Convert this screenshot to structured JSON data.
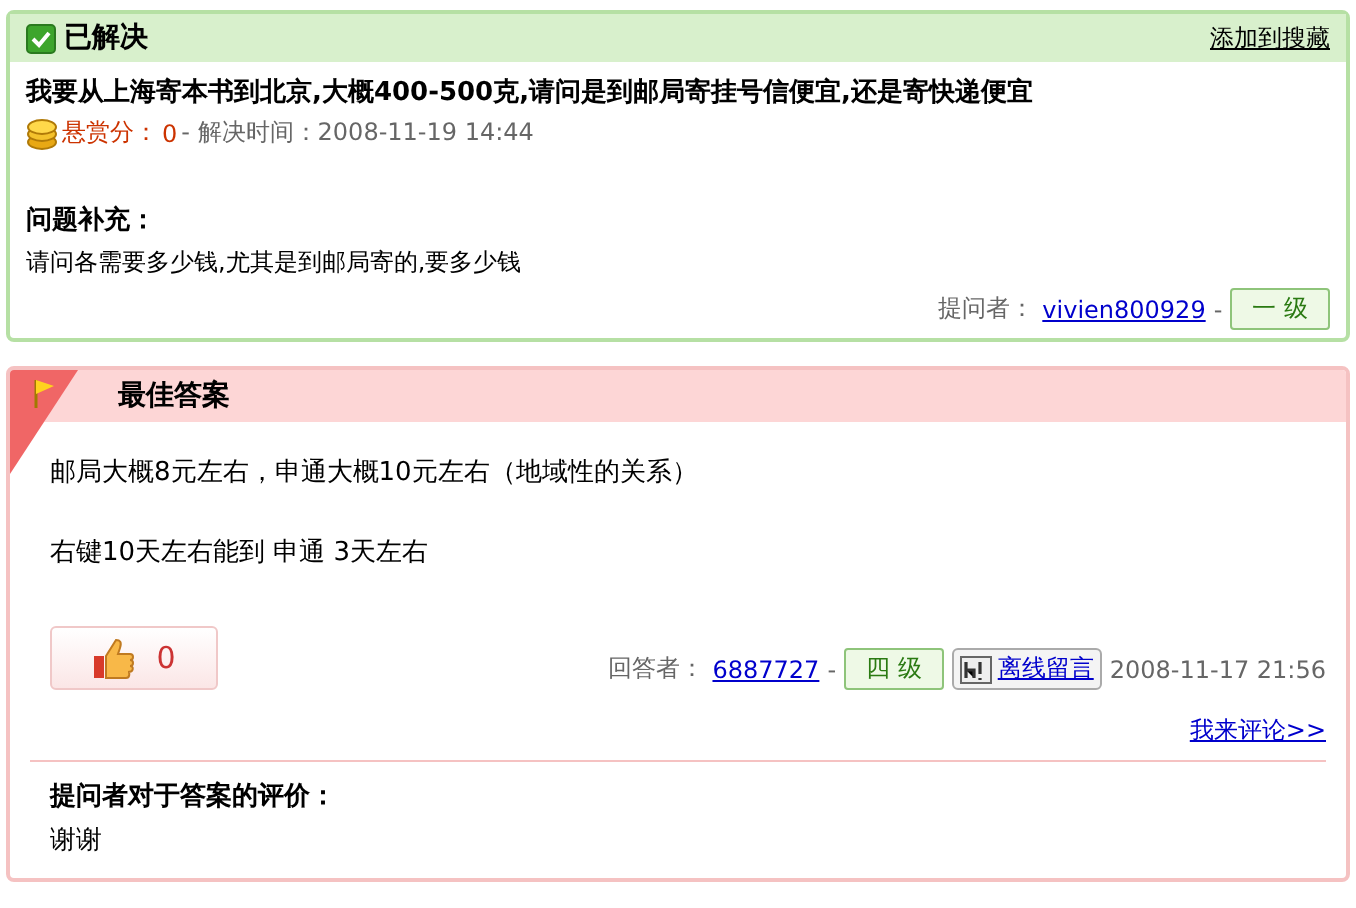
{
  "question": {
    "status": "已解决",
    "resolved": true,
    "add_link": "添加到搜藏",
    "title": "我要从上海寄本书到北京,大概400-500克,请问是到邮局寄挂号信便宜,还是寄快递便宜",
    "reward_label": "悬赏分：",
    "reward": "0",
    "solved_time": "- 解决时间：2008-11-19 14:44",
    "supplement_title": "问题补充：",
    "supplement": "请问各需要多少钱,尤其是到邮局寄的,要多少钱",
    "asker_label": "提问者：",
    "asker": "vivien800929",
    "separator": "-",
    "asker_level": "一 级"
  },
  "best_answer": {
    "title": "最佳答案",
    "paragraphs": [
      "邮局大概8元左右，申通大概10元左右（地域性的关系）",
      "右键10天左右能到  申通 3天左右"
    ],
    "likes": "0",
    "answerer_label": "回答者：",
    "answerer": "6887727",
    "separator": "-",
    "answerer_level": "四 级",
    "message_button": "离线留言",
    "time": "2008-11-17 21:56",
    "comment_link": "我来评论>>",
    "rating_title": "提问者对于答案的评价：",
    "rating_text": "谢谢"
  }
}
